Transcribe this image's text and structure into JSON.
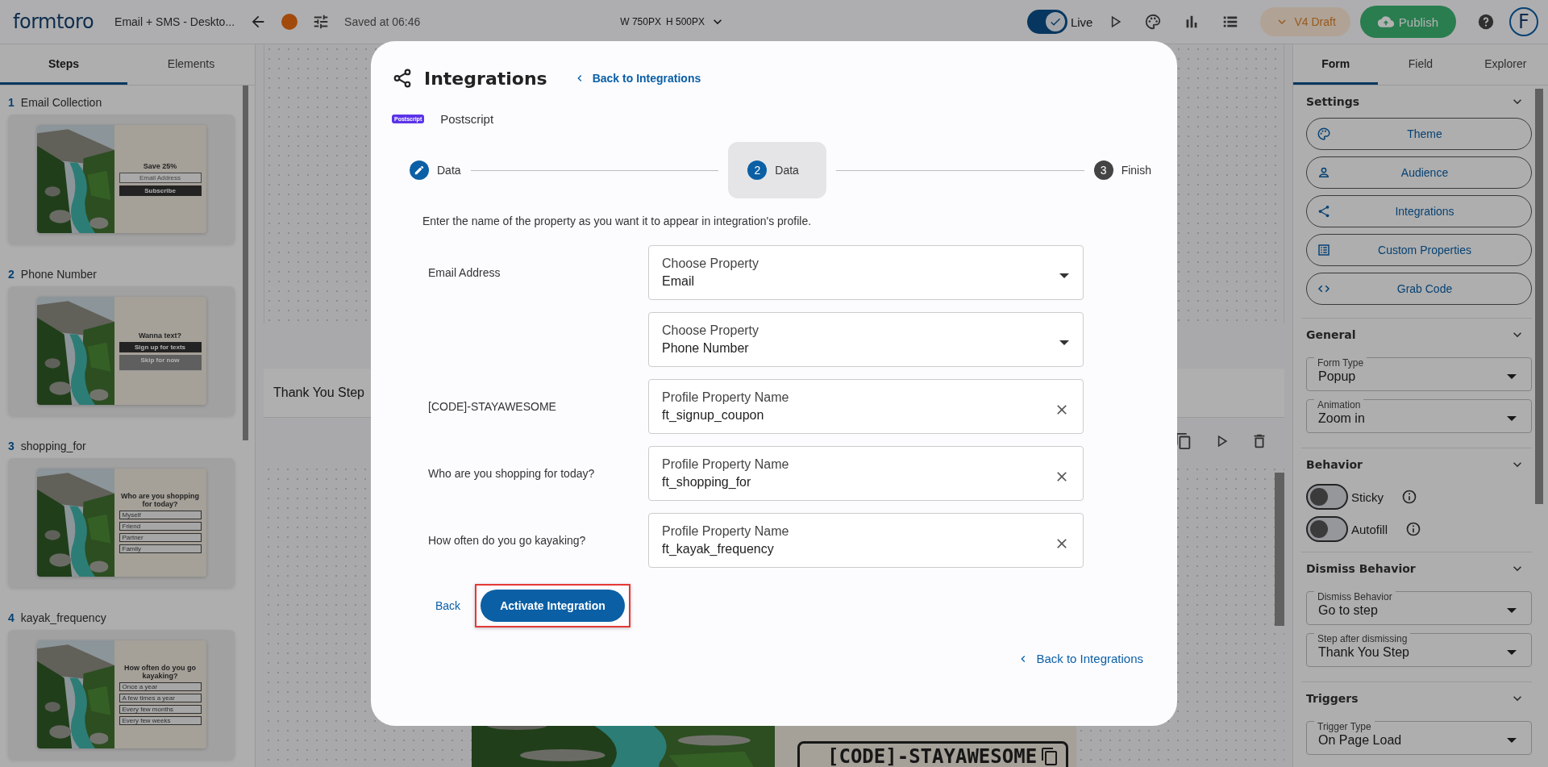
{
  "topbar": {
    "logo": "formtoro",
    "form_name": "Email + SMS - Deskto...",
    "saved": "Saved at 06:46",
    "width": "W 750PX",
    "height": "H 500PX",
    "live": {
      "label": "Live",
      "on": true
    },
    "version": "V4 Draft",
    "publish": "Publish",
    "avatar": "F"
  },
  "steps_panel": {
    "tabs": [
      {
        "label": "Steps",
        "selected": true
      },
      {
        "label": "Elements",
        "selected": false
      }
    ],
    "steps": [
      {
        "number": "1",
        "name": "Email Collection",
        "preview": {
          "heading": "Save 25%",
          "field": "Email Address",
          "buttons": [
            "Subscribe"
          ]
        }
      },
      {
        "number": "2",
        "name": "Phone Number",
        "preview": {
          "heading": "Wanna text?",
          "buttons": [
            "Sign up for texts",
            "Skip for now"
          ]
        }
      },
      {
        "number": "3",
        "name": "shopping_for",
        "preview": {
          "heading": "Who are you shopping for today?",
          "options": [
            "Myself",
            "Friend",
            "Partner",
            "Family"
          ]
        }
      },
      {
        "number": "4",
        "name": "kayak_frequency",
        "preview": {
          "heading": "How often do you go kayaking?",
          "options": [
            "Once a year",
            "A few times a year",
            "Every few months",
            "Every few weeks"
          ]
        }
      }
    ]
  },
  "canvas": {
    "step_title": "Thank You Step",
    "coupon_code": "[CODE]-STAYAWESOME"
  },
  "settings_panel": {
    "tabs": [
      {
        "label": "Form",
        "selected": true
      },
      {
        "label": "Field",
        "selected": false
      },
      {
        "label": "Explorer",
        "selected": false
      }
    ],
    "sections": [
      {
        "title": "Settings",
        "kind": "buttons",
        "items": [
          {
            "label": "Theme"
          },
          {
            "label": "Audience"
          },
          {
            "label": "Integrations"
          },
          {
            "label": "Custom Properties"
          },
          {
            "label": "Grab Code"
          }
        ]
      },
      {
        "title": "General",
        "kind": "selects",
        "items": [
          {
            "label": "Form Type",
            "value": "Popup"
          },
          {
            "label": "Animation",
            "value": "Zoom in"
          }
        ]
      },
      {
        "title": "Behavior",
        "kind": "toggles",
        "items": [
          {
            "label": "Sticky",
            "on": false
          },
          {
            "label": "Autofill",
            "on": false
          }
        ]
      },
      {
        "title": "Dismiss Behavior",
        "kind": "selects",
        "items": [
          {
            "label": "Dismiss Behavior",
            "value": "Go to step"
          },
          {
            "label": "Step after dismissing",
            "value": "Thank You Step"
          }
        ]
      },
      {
        "title": "Triggers",
        "kind": "selects",
        "items": [
          {
            "label": "Trigger Type",
            "value": "On Page Load"
          }
        ]
      }
    ]
  },
  "modal": {
    "title": "Integrations",
    "back_link": "Back to Integrations",
    "integration": {
      "logo": "Postscript",
      "name": "Postscript"
    },
    "stepper": [
      {
        "label": "Data",
        "completed": true,
        "selected": false
      },
      {
        "number": "2",
        "label": "Data",
        "completed": false,
        "selected": true
      },
      {
        "number": "3",
        "label": "Finish",
        "completed": false,
        "selected": false
      }
    ],
    "instructions": "Enter the name of the property as you want it to appear in integration's profile.",
    "mappings": [
      {
        "label": "Email Address",
        "kind": "select",
        "field_label": "Choose Property",
        "value": "Email"
      },
      {
        "kind": "select",
        "field_label": "Choose Property",
        "value": "Phone Number"
      },
      {
        "label": "[CODE]-STAYAWESOME",
        "kind": "text",
        "field_label": "Profile Property Name",
        "value": "ft_signup_coupon"
      },
      {
        "label": "Who are you shopping for today?",
        "kind": "text",
        "field_label": "Profile Property Name",
        "value": "ft_shopping_for"
      },
      {
        "label": "How often do you go kayaking?",
        "kind": "text",
        "field_label": "Profile Property Name",
        "value": "ft_kayak_frequency"
      }
    ],
    "back": "Back",
    "activate": "Activate Integration",
    "activate_highlighted": true,
    "footer_link": "Back to Integrations"
  }
}
